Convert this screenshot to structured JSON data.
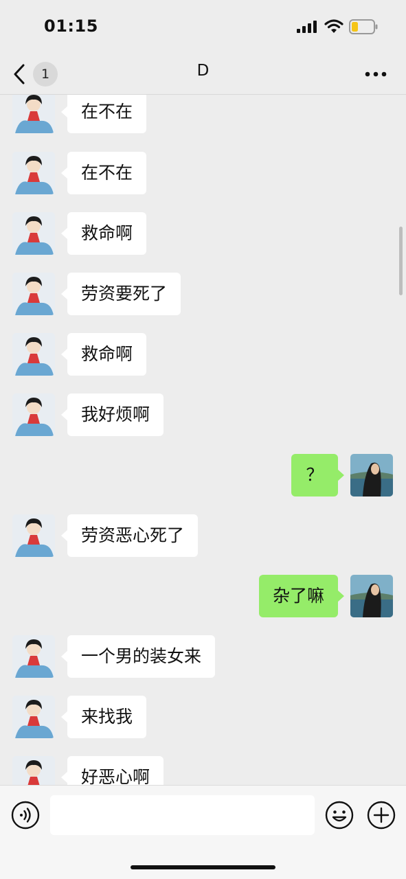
{
  "status_bar": {
    "time": "01:15",
    "battery_color": "#f5c518"
  },
  "header": {
    "back_badge": "1",
    "title": "D"
  },
  "messages": [
    {
      "side": "in",
      "text": "在不在"
    },
    {
      "side": "in",
      "text": "在不在"
    },
    {
      "side": "in",
      "text": "救命啊"
    },
    {
      "side": "in",
      "text": "劳资要死了"
    },
    {
      "side": "in",
      "text": "救命啊"
    },
    {
      "side": "in",
      "text": "我好烦啊"
    },
    {
      "side": "out",
      "text": "？"
    },
    {
      "side": "in",
      "text": "劳资恶心死了"
    },
    {
      "side": "out",
      "text": "杂了嘛"
    },
    {
      "side": "in",
      "text": "一个男的装女来"
    },
    {
      "side": "in",
      "text": "来找我"
    },
    {
      "side": "in",
      "text": "好恶心啊"
    }
  ],
  "input": {
    "value": "",
    "placeholder": ""
  },
  "colors": {
    "background": "#ededed",
    "incoming_bubble": "#ffffff",
    "outgoing_bubble": "#95ec69"
  }
}
